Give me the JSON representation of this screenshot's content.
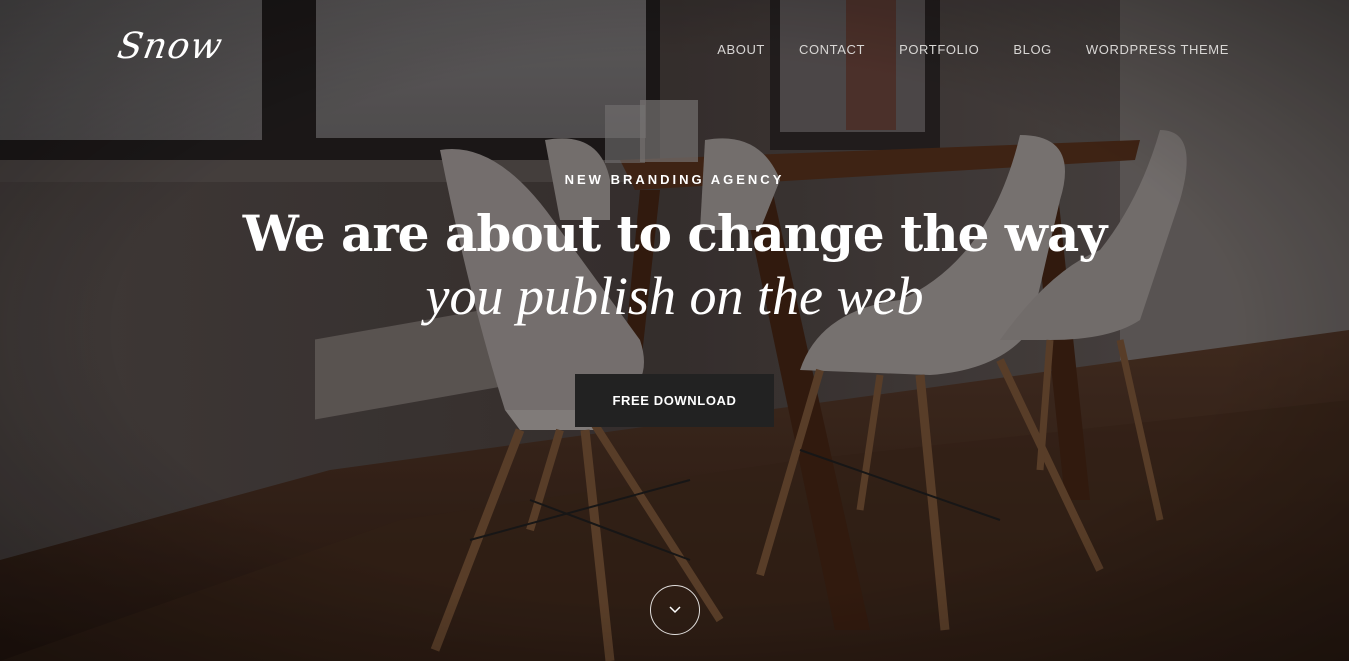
{
  "brand": {
    "logo_text": "Snow"
  },
  "nav": {
    "items": [
      {
        "label": "ABOUT"
      },
      {
        "label": "CONTACT"
      },
      {
        "label": "PORTFOLIO"
      },
      {
        "label": "BLOG"
      },
      {
        "label": "WORDPRESS THEME"
      }
    ]
  },
  "hero": {
    "eyebrow": "NEW BRANDING AGENCY",
    "headline": "We are about to change the way",
    "subheadline": "you publish on the web",
    "cta_label": "FREE DOWNLOAD",
    "scroll_icon": "chevron-down-icon"
  },
  "colors": {
    "text": "#ffffff",
    "nav_text": "#d8d6d4",
    "button_bg": "#222222"
  }
}
